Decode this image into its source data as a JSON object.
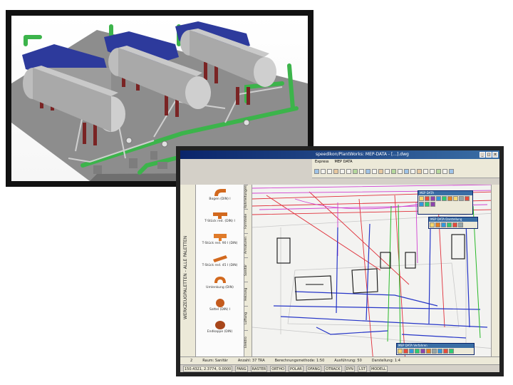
{
  "render": {
    "colors": {
      "tank": "#9a9a9a",
      "platform": "#2d3a9c",
      "pipe": "#3cb44b",
      "floor": "#8f8f8f",
      "valve": "#7a2424"
    }
  },
  "cad": {
    "title": "speedikon/PlantWorks: MEP-DATA - [...].dwg",
    "menu": [
      "Express",
      "MEP DATA"
    ],
    "palette": [
      {
        "label": "Bogen (DIN) I",
        "icon": "elbow-icon"
      },
      {
        "label": "T-Stück red. (DIN) I",
        "icon": "tee-icon"
      },
      {
        "label": "T-Stück red. 90 I (DIN)",
        "icon": "tee-reducer-icon"
      },
      {
        "label": "T-Stück red. 45 I (DIN)",
        "icon": "tee-45-icon"
      },
      {
        "label": "Umlenkung (DIN)",
        "icon": "bend-icon"
      },
      {
        "label": "Sattel (DIN) I",
        "icon": "saddle-icon"
      },
      {
        "label": "Endkappe (DIN)",
        "icon": "cap-icon"
      }
    ],
    "left_vertical_label": "WERKZEUGPALETTEN - ALLE PALETTEN",
    "tabs": [
      "Rohrleitungen",
      "Formteile",
      "Armaturen",
      "Sanitär",
      "Heizung",
      "Lüftung",
      "Elektro",
      "Kanal"
    ],
    "panels": [
      {
        "title": "MEP DATA"
      },
      {
        "title": "MEP DATA Darstellung"
      },
      {
        "title": "MEP DATA Verfahren"
      }
    ],
    "status": [
      "2",
      "Raum: Sanitär",
      "Anzahl: 37 TRA",
      "Berechnungsmethode: 1:50",
      "Ausführung: 50",
      "Darstellung: 1:4"
    ],
    "coords": [
      "150.4321, 2.3774, 0.0000",
      "FANG",
      "RASTER",
      "ORTHO",
      "POLAR",
      "OFANG",
      "OTRACK",
      "DYN",
      "LST",
      "MODELL"
    ]
  }
}
